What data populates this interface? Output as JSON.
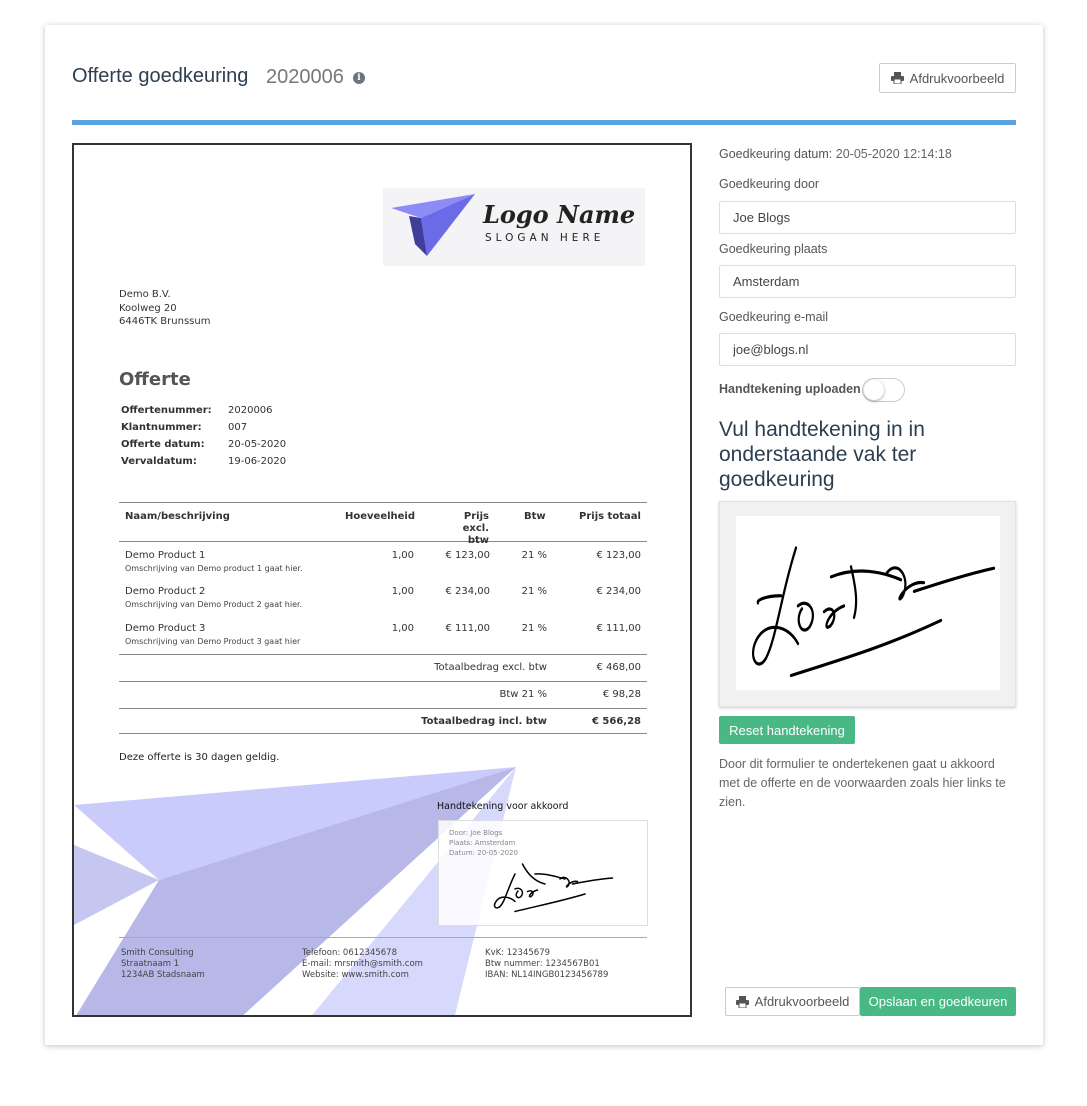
{
  "header": {
    "title": "Offerte goedkeuring",
    "number": "2020006",
    "info_icon": "i",
    "print_button": "Afdrukvoorbeeld"
  },
  "colors": {
    "accent_bar": "#5aa3e0",
    "green_button": "#48b884",
    "logo_plane": "#6b6be8"
  },
  "document": {
    "logo": {
      "name": "Logo Name",
      "slogan": "SLOGAN HERE"
    },
    "address": [
      "Demo B.V.",
      "Koolweg 20",
      "6446TK Brunssum"
    ],
    "heading": "Offerte",
    "meta": [
      {
        "key": "Offertenummer:",
        "value": "2020006"
      },
      {
        "key": "Klantnummer:",
        "value": "007"
      },
      {
        "key": "Offerte datum:",
        "value": "20-05-2020"
      },
      {
        "key": "Vervaldatum:",
        "value": "19-06-2020"
      }
    ],
    "table": {
      "headers": {
        "name": "Naam/beschrijving",
        "qty": "Hoeveelheid",
        "price_1": "Prijs excl.",
        "price_2": "btw",
        "vat": "Btw",
        "total": "Prijs totaal"
      },
      "rows": [
        {
          "name": "Demo Product 1",
          "desc": "Omschrijving van Demo product 1 gaat hier.",
          "qty": "1,00",
          "price": "€ 123,00",
          "vat": "21 %",
          "total": "€ 123,00"
        },
        {
          "name": "Demo Product 2",
          "desc": "Omschrijving van Demo Product 2 gaat hier.",
          "qty": "1,00",
          "price": "€ 234,00",
          "vat": "21 %",
          "total": "€ 234,00"
        },
        {
          "name": "Demo Product 3",
          "desc": "Omschrijving van Demo Product 3 gaat hier",
          "qty": "1,00",
          "price": "€ 111,00",
          "vat": "21 %",
          "total": "€ 111,00"
        }
      ],
      "totals": [
        {
          "label": "Totaalbedrag excl. btw",
          "value": "€ 468,00"
        },
        {
          "label": "Btw 21 %",
          "value": "€ 98,28"
        },
        {
          "label": "Totaalbedrag incl. btw",
          "value": "€ 566,28"
        }
      ]
    },
    "validity": "Deze offerte is 30 dagen geldig.",
    "signature": {
      "label": "Handtekening voor akkoord",
      "door": "Door: Joe Blogs",
      "plaats": "Plaats: Amsterdam",
      "datum": "Datum: 20-05-2020"
    },
    "footer": {
      "col1": [
        "Smith Consulting",
        "Straatnaam 1",
        "1234AB Stadsnaam"
      ],
      "col2": [
        "Telefoon: 0612345678",
        "E-mail: mrsmith@smith.com",
        "Website: www.smith.com"
      ],
      "col3": [
        "KvK: 12345679",
        "Btw nummer: 1234567B01",
        "IBAN: NL14INGB0123456789"
      ]
    }
  },
  "form": {
    "date_label": "Goedkeuring datum:",
    "date_value": "20-05-2020 12:14:18",
    "by_label": "Goedkeuring door",
    "by_value": "Joe Blogs",
    "place_label": "Goedkeuring plaats",
    "place_value": "Amsterdam",
    "email_label": "Goedkeuring e-mail",
    "email_value": "joe@blogs.nl",
    "upload_label": "Handtekening uploaden :",
    "upload_enabled": false,
    "heading": "Vul handtekening in in onderstaande vak ter goedkeuring",
    "reset_button": "Reset handtekening",
    "notice": "Door dit formulier te ondertekenen gaat u akkoord met de offerte en de voorwaarden zoals hier links te zien.",
    "print_button": "Afdrukvoorbeeld",
    "submit_button": "Opslaan en goedkeuren"
  }
}
